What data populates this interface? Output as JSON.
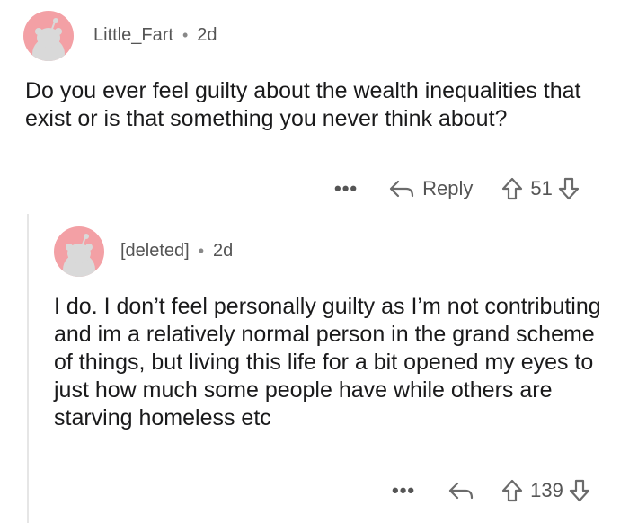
{
  "comments": [
    {
      "username": "Little_Fart",
      "time": "2d",
      "text": "Do you ever feel guilty about the wealth inequalities that exist or is that something you never think about?",
      "reply_label": "Reply",
      "votes": "51",
      "more": "•••"
    },
    {
      "username": "[deleted]",
      "time": "2d",
      "text": "I do. I don’t feel personally guilty as I’m not contributing and im a relatively normal person in the grand scheme of things, but living this life for a bit opened my eyes to just how much some people have while others are starving homeless etc",
      "votes": "139",
      "more": "•••"
    }
  ],
  "separator": "•",
  "colors": {
    "avatar_bg": "#f3a0a5",
    "avatar_figure": "#d9d9d9",
    "text": "#1a1a1b",
    "meta": "#555555"
  },
  "icons": [
    "reddit-avatar-icon",
    "reply-arrow-icon",
    "upvote-arrow-icon",
    "downvote-arrow-icon",
    "more-dots-icon"
  ]
}
